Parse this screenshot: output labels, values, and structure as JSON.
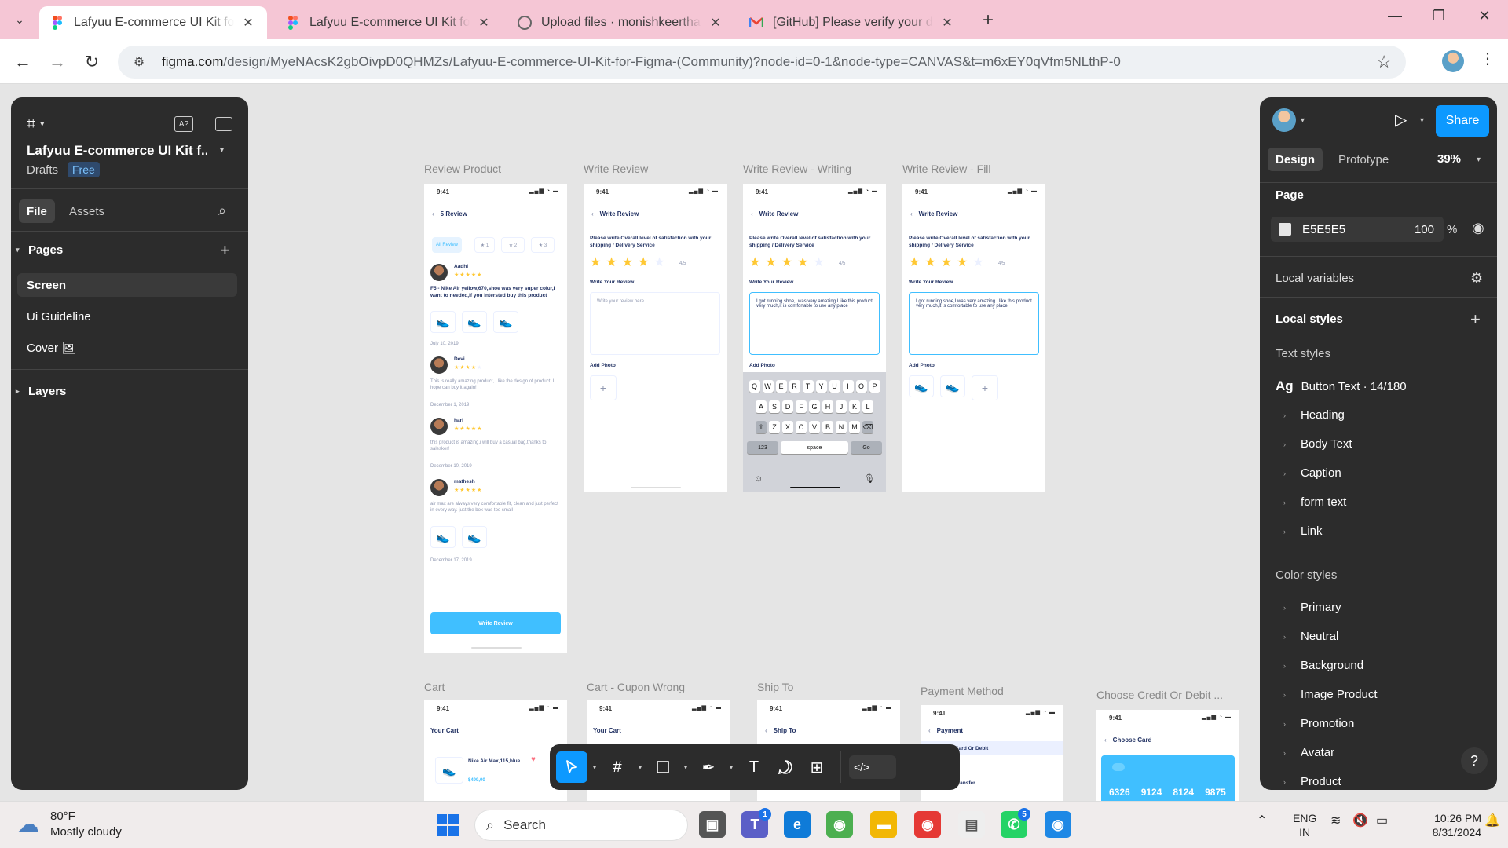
{
  "browser": {
    "tabs": [
      {
        "title": "Lafyuu E-commerce UI Kit for Fi",
        "icon": "figma-icon",
        "active": true
      },
      {
        "title": "Lafyuu E-commerce UI Kit for Fi",
        "icon": "figma-icon",
        "active": false
      },
      {
        "title": "Upload files · monishkeerthana/",
        "icon": "github-icon",
        "active": false
      },
      {
        "title": "[GitHub] Please verify your devi",
        "icon": "gmail-icon",
        "active": false
      }
    ],
    "url_host": "figma.com",
    "url_path": "/design/MyeNAcsK2gbOivpD0QHMZs/Lafyuu-E-commerce-UI-Kit-for-Figma-(Community)?node-id=0-1&node-type=CANVAS&t=m6xEY0qVfm5NLthP-0"
  },
  "left_panel": {
    "file_title": "Lafyuu E-commerce UI Kit f...",
    "drafts": "Drafts",
    "plan_badge": "Free",
    "tab_file": "File",
    "tab_assets": "Assets",
    "pages_label": "Pages",
    "pages": [
      "Screen",
      "Ui Guideline",
      "Cover 🖼"
    ],
    "layers_label": "Layers"
  },
  "right_panel": {
    "share": "Share",
    "tab_design": "Design",
    "tab_prototype": "Prototype",
    "zoom": "39%",
    "page_label": "Page",
    "page_color_hex": "E5E5E5",
    "page_opacity": "100",
    "page_opacity_unit": "%",
    "local_variables": "Local variables",
    "local_styles": "Local styles",
    "text_styles": "Text styles",
    "button_text": "Button Text · 14/180",
    "ag": "Ag",
    "text_style_groups": [
      "Heading",
      "Body Text",
      "Caption",
      "form text",
      "Link"
    ],
    "color_styles": "Color styles",
    "color_style_groups": [
      "Primary",
      "Neutral",
      "Background",
      "Image Product",
      "Promotion",
      "Avatar",
      "Product"
    ],
    "help": "?"
  },
  "canvas": {
    "frames_top": [
      "Review Product",
      "Write Review",
      "Write Review - Writing",
      "Write Review - Fill"
    ],
    "frames_bottom": [
      "Cart",
      "Cart - Cupon Wrong",
      "Ship To",
      "Payment Method",
      "Choose Credit Or Debit ..."
    ],
    "time": "9:41",
    "review_product": {
      "header": "5 Review",
      "chips": [
        "All Review",
        "★ 1",
        "★ 2",
        "★ 3"
      ],
      "reviews": [
        {
          "name": "Aadhi",
          "text": "F5 - Nike Air yellow,670,shoe was very super colur,I want to needed,if you intersted buy this product",
          "date": "July 10, 2019"
        },
        {
          "name": "Devi",
          "text": "This is really amazing product, i like the design of product, I hope can buy it again!",
          "date": "December 1, 2019"
        },
        {
          "name": "hari",
          "text": "this product is amazing,i will buy a casual bag,thanks to salesker!",
          "date": "December 10, 2019"
        },
        {
          "name": "mathesh",
          "text": "air max are always very comfortable fit, clean and just perfect in every way. just the box was too small",
          "date": "December 17, 2019"
        }
      ],
      "button": "Write Review"
    },
    "write_review": {
      "header": "Write Review",
      "question": "Please write Overall level of satisfaction with your shipping / Delivery Service",
      "rating": "4/5",
      "write_label": "Write Your Review",
      "placeholder": "Write your review here",
      "typed": "I got running shoe,I was very amazing I like this product very much,it is comfortable to use any place",
      "add_photo": "Add Photo"
    },
    "keyboard": {
      "row1": [
        "Q",
        "W",
        "E",
        "R",
        "T",
        "Y",
        "U",
        "I",
        "O",
        "P"
      ],
      "row2": [
        "A",
        "S",
        "D",
        "F",
        "G",
        "H",
        "J",
        "K",
        "L"
      ],
      "row3": [
        "Z",
        "X",
        "C",
        "V",
        "B",
        "N",
        "M"
      ],
      "num": "123",
      "space": "space",
      "go": "Go"
    },
    "cart": {
      "header": "Your Cart",
      "item": "Nike Air Max,115,blue",
      "price": "$499,00"
    },
    "cart_wrong": {
      "header": "Your Cart"
    },
    "ship_to": {
      "header": "Ship To"
    },
    "payment": {
      "header": "Payment",
      "item1": "Card Or Debit",
      "item2": "Transfer"
    },
    "choose_card": {
      "header": "Choose Card",
      "number": [
        "6326",
        "9124",
        "8124",
        "9875"
      ]
    }
  },
  "taskbar": {
    "temp": "80°F",
    "weather": "Mostly cloudy",
    "search": "Search",
    "lang1": "ENG",
    "lang2": "IN",
    "time": "10:26 PM",
    "date": "8/31/2024",
    "teams_badge": "1",
    "whatsapp_badge": "5"
  }
}
